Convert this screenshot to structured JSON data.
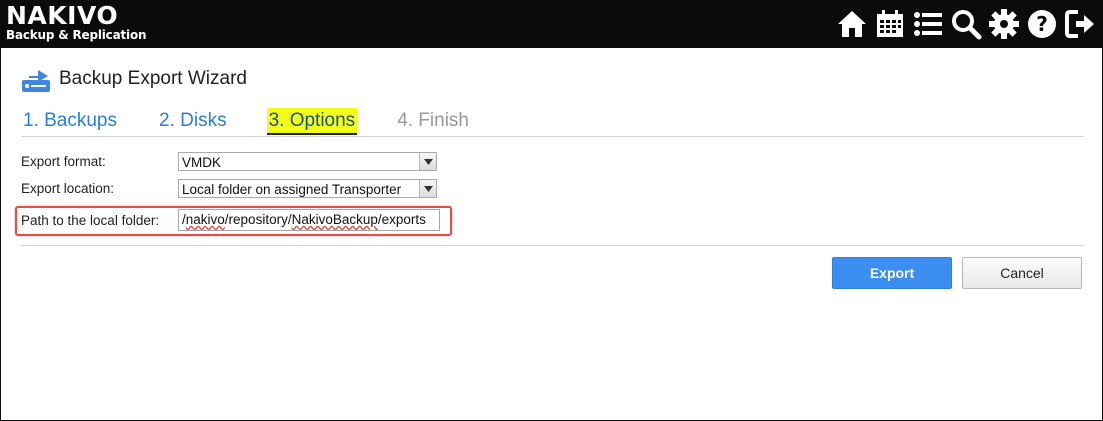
{
  "header": {
    "brand": "NAKIVO",
    "tagline": "Backup & Replication",
    "icons": [
      "home-icon",
      "calendar-icon",
      "list-icon",
      "search-icon",
      "gear-icon",
      "help-icon",
      "logout-icon"
    ]
  },
  "wizard": {
    "icon": "export-icon",
    "title": "Backup Export Wizard",
    "steps": [
      {
        "label": "1. Backups",
        "state": "done"
      },
      {
        "label": "2. Disks",
        "state": "done"
      },
      {
        "label": "3. Options",
        "state": "active"
      },
      {
        "label": "4. Finish",
        "state": "disabled"
      }
    ],
    "form": {
      "export_format": {
        "label": "Export format:",
        "value": "VMDK"
      },
      "export_location": {
        "label": "Export location:",
        "value": "Local folder on assigned Transporter"
      },
      "local_path": {
        "label": "Path to the local folder:",
        "value_prefix": "/",
        "value_nakivo": "nakivo",
        "value_mid": "/repository/",
        "value_backup": "NakivoBackup",
        "value_suffix": "/exports"
      }
    },
    "buttons": {
      "export": "Export",
      "cancel": "Cancel"
    }
  },
  "colors": {
    "accent": "#3c8ef1",
    "step_link": "#2a7fd1",
    "highlight": "#f2ff16",
    "callout": "#e0504a"
  }
}
